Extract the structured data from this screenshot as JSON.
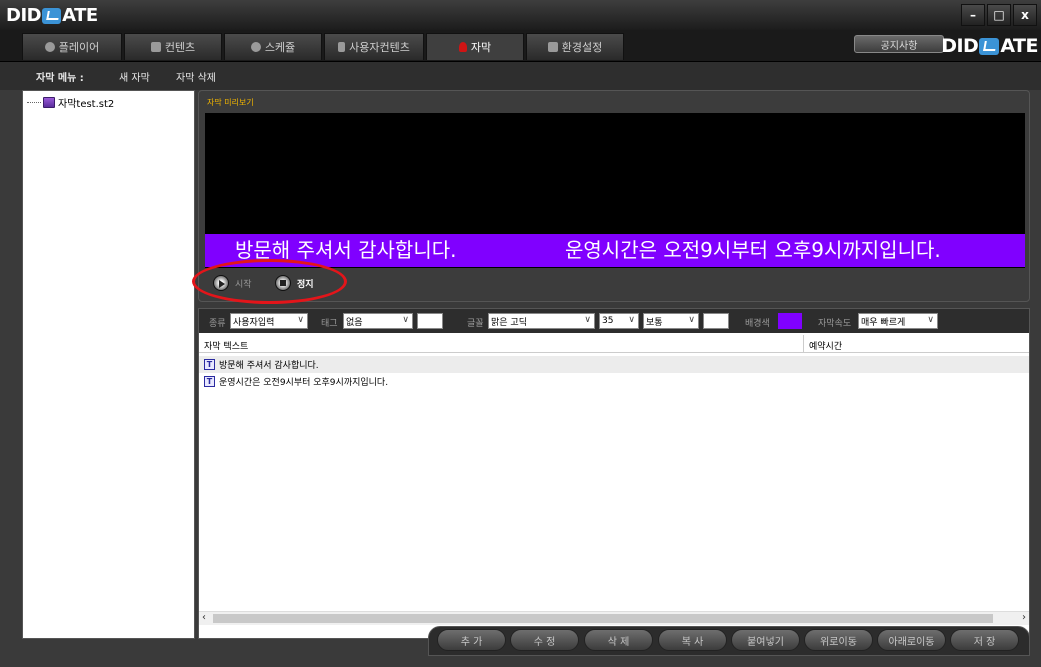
{
  "app": {
    "logo": "DID",
    "logo_suffix": "ATE"
  },
  "window_controls": {
    "minimize": "–",
    "maximize": "□",
    "close": "x"
  },
  "tabs": [
    {
      "label": "플레이어",
      "icon": "play-icon"
    },
    {
      "label": "컨텐츠",
      "icon": "contents-icon"
    },
    {
      "label": "스케쥴",
      "icon": "schedule-icon"
    },
    {
      "label": "사용자컨텐츠",
      "icon": "user-content-icon"
    },
    {
      "label": "자막",
      "icon": "subtitle-icon",
      "active": true
    },
    {
      "label": "환경설정",
      "icon": "settings-icon"
    }
  ],
  "notice_button": "공지사항",
  "menu": {
    "title": "자막 메뉴 :",
    "new": "새 자막",
    "delete": "자막 삭제"
  },
  "tree": {
    "file": "자막test.st2"
  },
  "preview": {
    "title": "자막 미리보기",
    "marquee_1": "방문해 주셔서 감사합니다.",
    "marquee_2": "운영시간은 오전9시부터 오후9시까지입니다.",
    "marquee_bg": "#8000ff",
    "start": "시작",
    "stop": "정지"
  },
  "toolbar": {
    "type_label": "종류",
    "type_value": "사용자입력",
    "tag_label": "태그",
    "tag_value": "없음",
    "font_label": "글꼴",
    "font_value": "맑은 고딕",
    "size_value": "35",
    "style_value": "보통",
    "bg_label": "배경색",
    "bg_color": "#8000ff",
    "speed_label": "자막속도",
    "speed_value": "매우 빠르게"
  },
  "grid": {
    "col_text": "자막 텍스트",
    "col_time": "예약시간",
    "rows": [
      {
        "text": "방문해 주셔서 감사합니다."
      },
      {
        "text": "운영시간은 오전9시부터 오후9시까지입니다."
      }
    ]
  },
  "actions": [
    "추 가",
    "수 정",
    "삭 제",
    "복 사",
    "붙여넣기",
    "위로이동",
    "아래로이동",
    "저 장"
  ]
}
